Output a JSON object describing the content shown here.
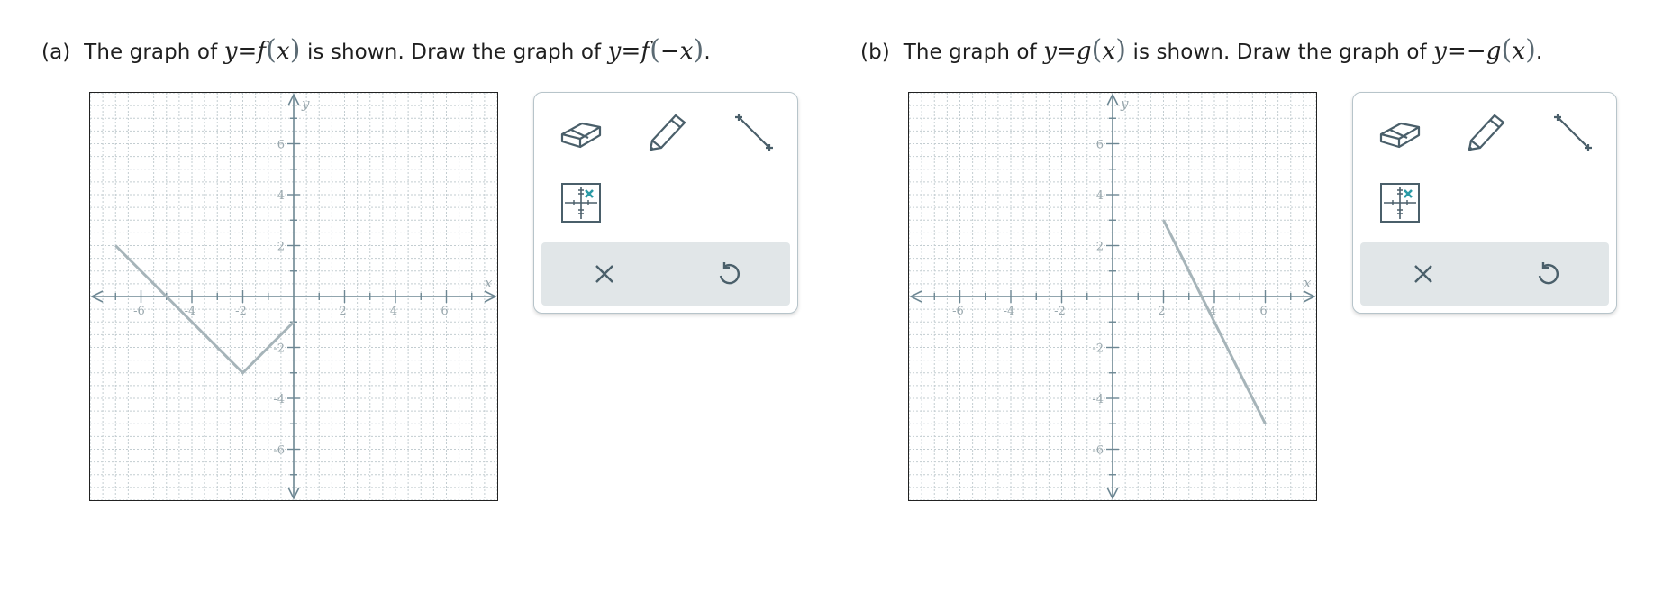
{
  "problems": [
    {
      "label": "(a)",
      "text1": "The graph of",
      "given_y": "y",
      "given_eq": "=",
      "given_fn": "f",
      "given_open": "(",
      "given_arg": "x",
      "given_close": ")",
      "text2": "is shown. Draw the graph of",
      "target_y": "y",
      "target_eq": "=",
      "target_neg": "",
      "target_fn": "f",
      "target_open": "(",
      "target_arg": "−x",
      "target_close": ")",
      "end": ".",
      "graph": {
        "x_axis_label": "x",
        "y_axis_label": "y",
        "xlim": [
          -8,
          8
        ],
        "ylim": [
          -8,
          8
        ],
        "x_tick_labels": [
          "-6",
          "-4",
          "-2",
          "2",
          "4",
          "6"
        ],
        "y_tick_labels": [
          "6",
          "4",
          "2",
          "-2",
          "-4",
          "-6"
        ],
        "grid": true,
        "curve_points": [
          [
            -7,
            2
          ],
          [
            -2,
            -3
          ],
          [
            0,
            -1
          ]
        ],
        "curve_color": "#a6b4b9"
      }
    },
    {
      "label": "(b)",
      "text1": "The graph of",
      "given_y": "y",
      "given_eq": "=",
      "given_fn": "g",
      "given_open": "(",
      "given_arg": "x",
      "given_close": ")",
      "text2": "is shown. Draw the graph of",
      "target_y": "y",
      "target_eq": "=",
      "target_neg": "−",
      "target_fn": "g",
      "target_open": "(",
      "target_arg": "x",
      "target_close": ")",
      "end": ".",
      "graph": {
        "x_axis_label": "x",
        "y_axis_label": "y",
        "xlim": [
          -8,
          8
        ],
        "ylim": [
          -8,
          8
        ],
        "x_tick_labels": [
          "-6",
          "-4",
          "-2",
          "2",
          "4",
          "6"
        ],
        "y_tick_labels": [
          "6",
          "4",
          "2",
          "-2",
          "-4",
          "-6"
        ],
        "grid": true,
        "curve_points": [
          [
            2,
            3
          ],
          [
            6,
            -5
          ]
        ],
        "curve_color": "#a6b4b9"
      }
    }
  ],
  "toolbar": {
    "tools": [
      "eraser-icon",
      "pencil-icon",
      "line-segment-icon",
      "point-tool-icon"
    ],
    "actions": [
      "clear-icon",
      "undo-icon"
    ],
    "icon_color": "#4a5f6a",
    "accent_color": "#2b9aa6",
    "action_bar_color": "#e1e6e8"
  },
  "colors": {
    "axis": "#6d8793",
    "grid": "#c3cdd1",
    "tick_label": "#9aa8ae"
  }
}
